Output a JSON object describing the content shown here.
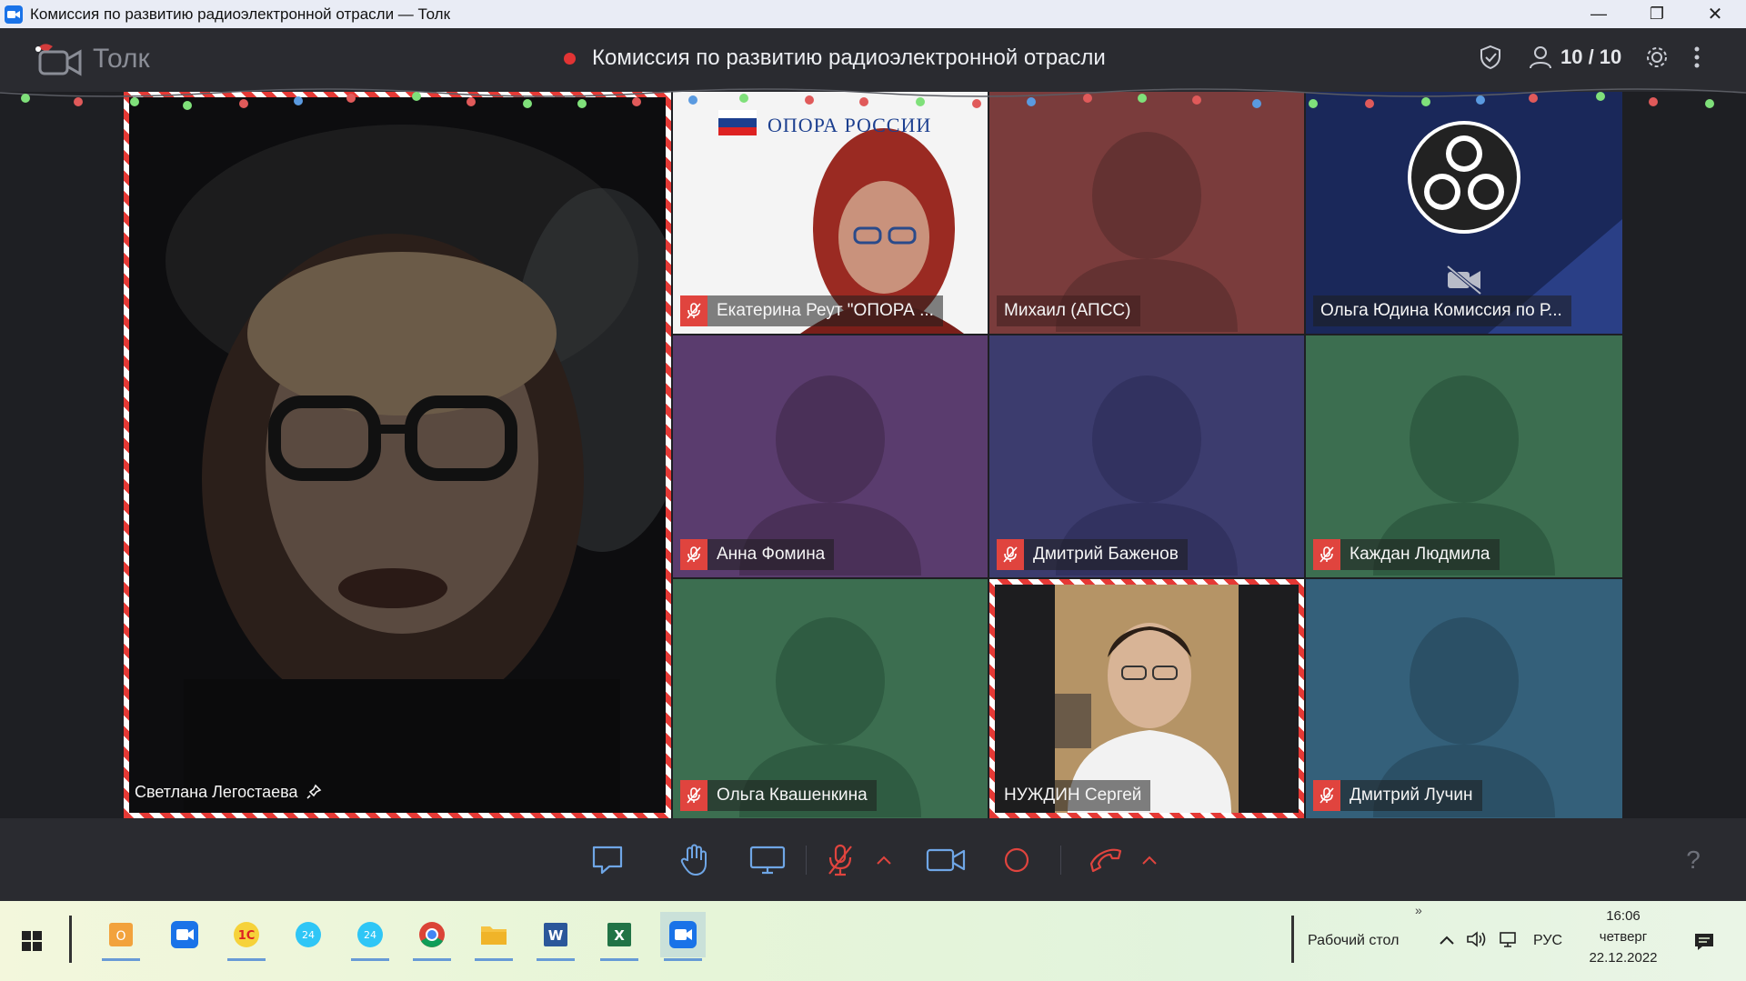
{
  "window": {
    "title": "Комиссия по развитию радиоэлектронной отрасли — Толк",
    "minimize": "—",
    "maximize": "❐",
    "close": "✕"
  },
  "header": {
    "app_name": "Толк",
    "meeting_title": "Комиссия по развитию радиоэлектронной отрасли",
    "participants_count": "10 / 10"
  },
  "participants": {
    "main": {
      "name": "Светлана Легостаева"
    },
    "p1": {
      "name": "Екатерина Реут \"ОПОРА ...",
      "org_banner": "ОПОРА РОССИИ"
    },
    "p2": {
      "name": "Михаил (АПСС)"
    },
    "p3": {
      "name": "Ольга Юдина Комиссия по Р..."
    },
    "p4": {
      "name": "Анна Фомина"
    },
    "p5": {
      "name": "Дмитрий Баженов"
    },
    "p6": {
      "name": "Каждан Людмила"
    },
    "p7": {
      "name": "Ольга Квашенкина"
    },
    "p8": {
      "name": "НУЖДИН Сергей"
    },
    "p9": {
      "name": "Дмитрий Лучин"
    }
  },
  "toolbar": {
    "help": "?"
  },
  "taskbar": {
    "desktop_label": "Рабочий стол",
    "chevron": "»",
    "language": "РУС",
    "time": "16:06",
    "weekday": "четверг",
    "date": "22.12.2022"
  },
  "colors": {
    "header_bg": "#2a2b30",
    "mic_off": "#e0443e",
    "rec": "#e23434"
  }
}
